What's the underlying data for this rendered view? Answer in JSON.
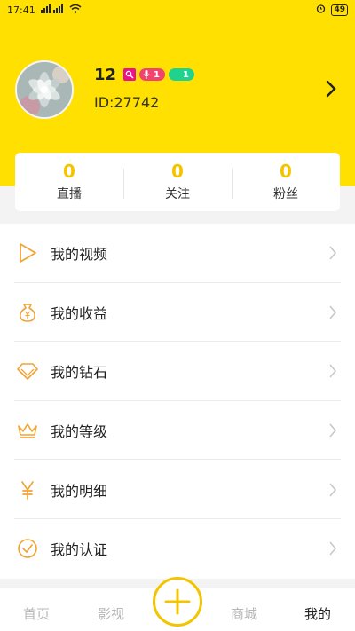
{
  "status_bar": {
    "time": "17:41",
    "network_label": "4G",
    "battery": "49"
  },
  "profile": {
    "username": "12",
    "user_id": "ID:27742",
    "badges": [
      {
        "icon": "search-badge-icon",
        "color": "#e8158a"
      },
      {
        "icon": "mic-icon",
        "count": "1",
        "color": "#f0436e"
      },
      {
        "icon": "moon-icon",
        "count": "1",
        "color": "#1fd38e"
      }
    ]
  },
  "stats": [
    {
      "value": "0",
      "label": "直播"
    },
    {
      "value": "0",
      "label": "关注"
    },
    {
      "value": "0",
      "label": "粉丝"
    }
  ],
  "menu": [
    {
      "label": "我的视频",
      "icon": "play-icon"
    },
    {
      "label": "我的收益",
      "icon": "money-bag-icon"
    },
    {
      "label": "我的钻石",
      "icon": "diamond-icon"
    },
    {
      "label": "我的等级",
      "icon": "crown-icon"
    },
    {
      "label": "我的明细",
      "icon": "yen-icon"
    },
    {
      "label": "我的认证",
      "icon": "check-circle-icon"
    }
  ],
  "tabs": {
    "home": "首页",
    "video": "影视",
    "mall": "商城",
    "mine": "我的"
  },
  "colors": {
    "brand_yellow": "#ffe000",
    "accent_gold": "#f4c400",
    "icon_orange": "#f0a436"
  }
}
